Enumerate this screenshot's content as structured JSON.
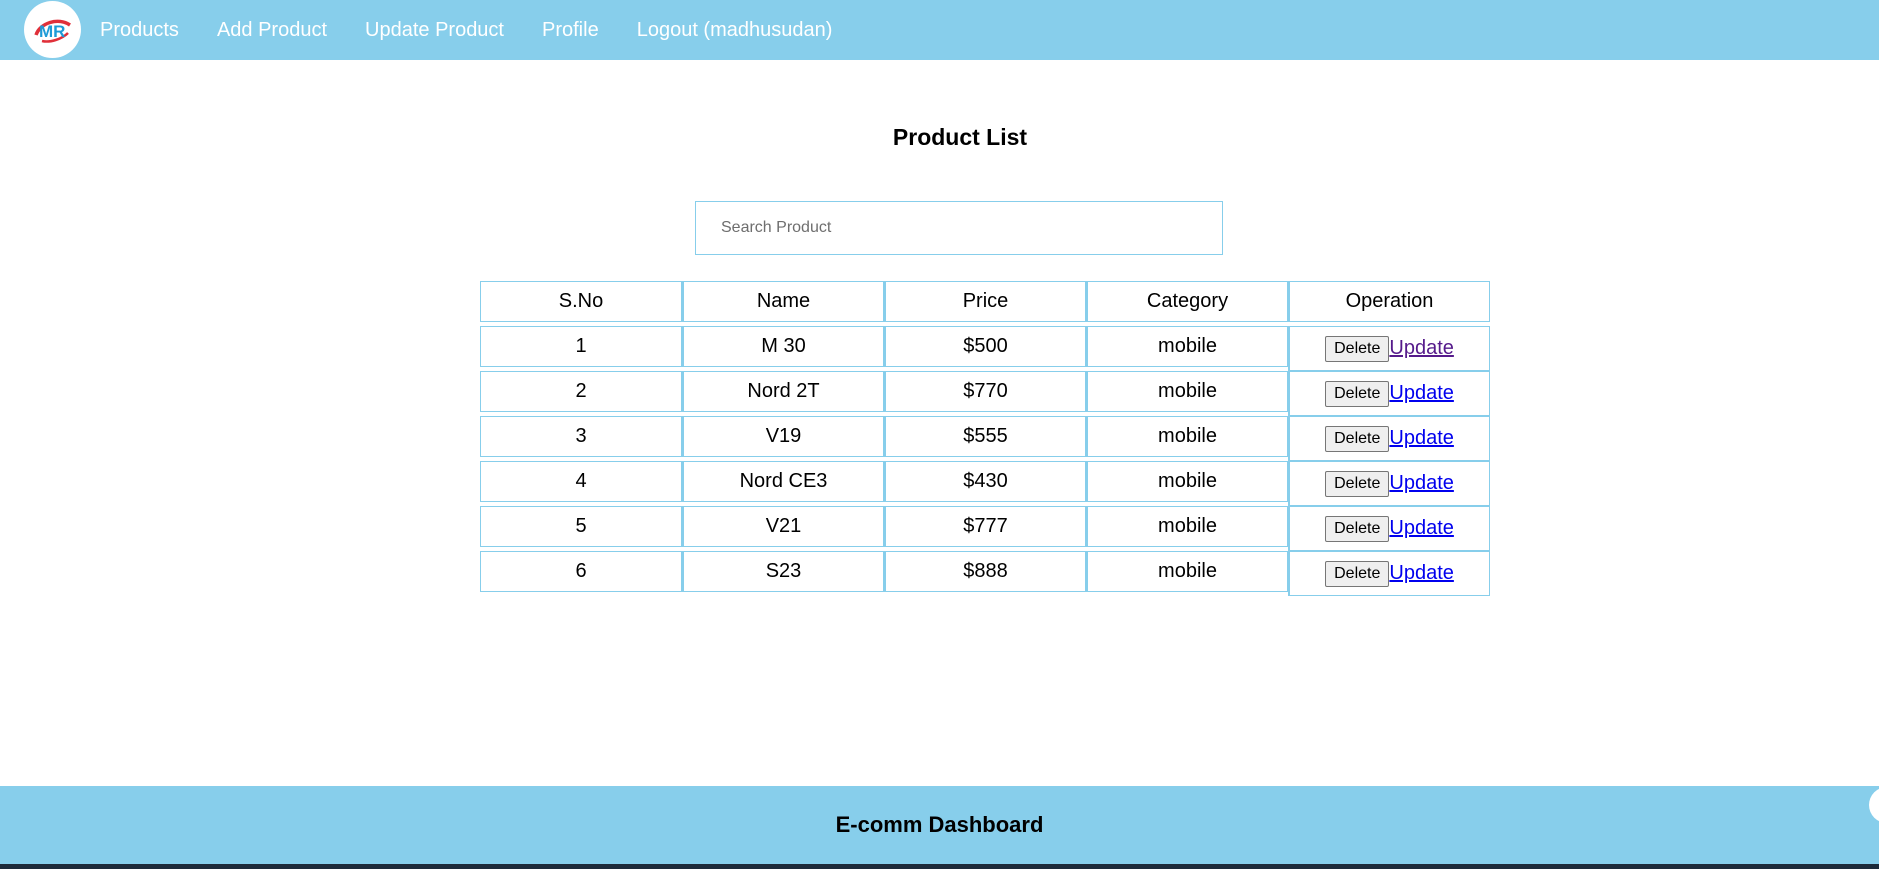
{
  "nav": {
    "logo_text": "MR",
    "links": [
      {
        "label": "Products"
      },
      {
        "label": "Add Product"
      },
      {
        "label": "Update Product"
      },
      {
        "label": "Profile"
      },
      {
        "label": "Logout (madhusudan)"
      }
    ]
  },
  "main": {
    "title": "Product List",
    "search": {
      "placeholder": "Search Product",
      "value": ""
    },
    "table": {
      "headers": [
        "S.No",
        "Name",
        "Price",
        "Category",
        "Operation"
      ],
      "rows": [
        {
          "sno": "1",
          "name": "M 30",
          "price": "$500",
          "category": "mobile",
          "delete_label": "Delete",
          "update_label": "Update"
        },
        {
          "sno": "2",
          "name": "Nord 2T",
          "price": "$770",
          "category": "mobile",
          "delete_label": "Delete",
          "update_label": "Update"
        },
        {
          "sno": "3",
          "name": "V19",
          "price": "$555",
          "category": "mobile",
          "delete_label": "Delete",
          "update_label": "Update"
        },
        {
          "sno": "4",
          "name": "Nord CE3",
          "price": "$430",
          "category": "mobile",
          "delete_label": "Delete",
          "update_label": "Update"
        },
        {
          "sno": "5",
          "name": "V21",
          "price": "$777",
          "category": "mobile",
          "delete_label": "Delete",
          "update_label": "Update"
        },
        {
          "sno": "6",
          "name": "S23",
          "price": "$888",
          "category": "mobile",
          "delete_label": "Delete",
          "update_label": "Update"
        }
      ]
    }
  },
  "footer": {
    "text": "E-comm Dashboard"
  },
  "colors": {
    "accent": "#87ceeb",
    "link": "#0000ee",
    "visited_link": "#551a8b"
  }
}
